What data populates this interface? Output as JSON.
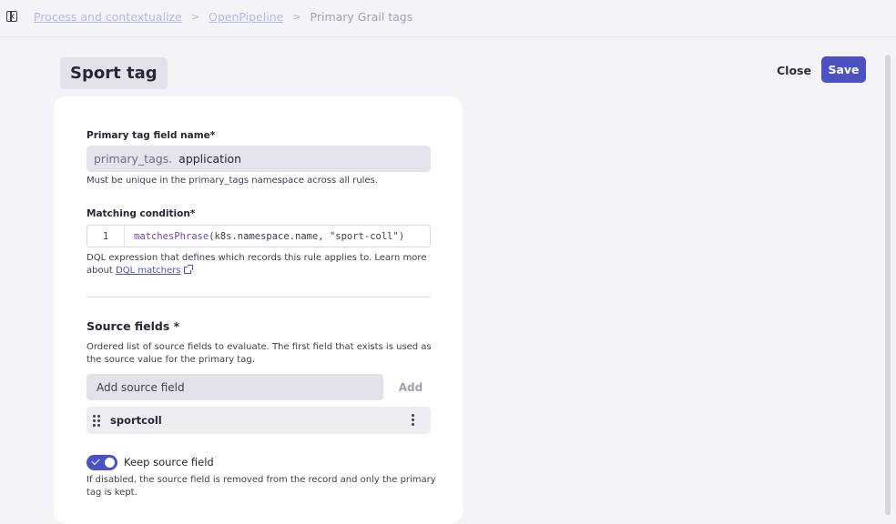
{
  "breadcrumb": {
    "items": [
      "Process and contextualize",
      "OpenPipeline"
    ],
    "separator": ">",
    "current": "Primary Grail tags"
  },
  "header": {
    "title": "Sport tag",
    "close_label": "Close",
    "save_label": "Save"
  },
  "form": {
    "primary_tag": {
      "label": "Primary tag field name*",
      "prefix": "primary_tags.",
      "value": "application",
      "help": "Must be unique in the primary_tags namespace across all rules."
    },
    "matching_condition": {
      "label": "Matching condition*",
      "line_number": "1",
      "code_fn": "matchesPhrase",
      "code_args": "(k8s.namespace.name, ",
      "code_str": "\"sport-coll\"",
      "code_close": ")",
      "help_text": "DQL expression that defines which records this rule applies to. Learn more",
      "help_prefix": "about",
      "help_link": "DQL matchers"
    },
    "source_fields": {
      "title": "Source fields *",
      "help_line1": "Ordered list of source fields to evaluate. The first field that exists is used as",
      "help_line2": "the source value for the primary tag.",
      "placeholder": "Add source field",
      "add_label": "Add",
      "items": [
        {
          "label": "sportcoll"
        }
      ]
    },
    "keep_source": {
      "label": "Keep source field",
      "enabled": true,
      "help_line1": "If disabled, the source field is removed from the record and only the primary",
      "help_line2": "tag is kept."
    }
  },
  "colors": {
    "accent": "#4d52c3",
    "breadcrumb_link": "#b6b8e8"
  }
}
